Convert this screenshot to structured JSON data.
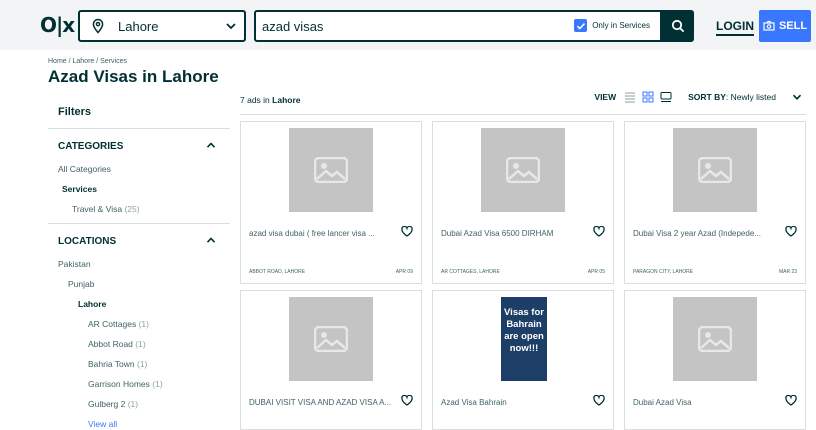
{
  "header": {
    "logo": "OLX",
    "location": "Lahore",
    "search_query": "azad visas",
    "only_in_label": "Only in Services",
    "only_in_checked": true,
    "login_label": "LOGIN",
    "sell_label": "SELL",
    "accent_color": "#3a77ff",
    "brand_color": "#002f34"
  },
  "breadcrumb": "Home / Lahore / Services",
  "page_title": "Azad Visas in Lahore",
  "sidebar": {
    "filters_label": "Filters",
    "categories": {
      "title": "CATEGORIES",
      "all": "All Categories",
      "current": "Services",
      "sub": {
        "label": "Travel & Visa",
        "count": "(25)"
      }
    },
    "locations": {
      "title": "LOCATIONS",
      "country": "Pakistan",
      "province": "Punjab",
      "city": "Lahore",
      "areas": [
        {
          "label": "AR Cottages",
          "count": "(1)"
        },
        {
          "label": "Abbot Road",
          "count": "(1)"
        },
        {
          "label": "Bahria Town",
          "count": "(1)"
        },
        {
          "label": "Garrison Homes",
          "count": "(1)"
        },
        {
          "label": "Gulberg 2",
          "count": "(1)"
        }
      ],
      "view_all": "View all"
    }
  },
  "results": {
    "count_text": "7 ads in",
    "location": "Lahore",
    "view_label": "VIEW",
    "sort_label": "SORT BY",
    "sort_value": ": Newly listed"
  },
  "listings": [
    {
      "title": "azad visa dubai ( free lancer visa ...",
      "location": "Abbot Road, Lahore",
      "date": "Apr 09"
    },
    {
      "title": "Dubai Azad Visa 6500 DIRHAM",
      "location": "AR Cottages, Lahore",
      "date": "Apr 05"
    },
    {
      "title": "Dubai Visa 2 year Azad (Indepede...",
      "location": "Paragon City, Lahore",
      "date": "Mar 23"
    },
    {
      "title": "DUBAI VISIT VISA AND AZAD VISA A...",
      "location": "",
      "date": ""
    },
    {
      "title": "Azad Visa Bahrain",
      "location": "",
      "date": "",
      "photo_text": "Visas for Bahrain are open now!!!"
    },
    {
      "title": "Dubai Azad Visa",
      "location": "",
      "date": ""
    }
  ]
}
